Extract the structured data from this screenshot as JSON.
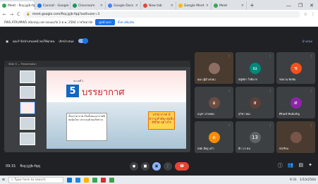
{
  "tabs": [
    {
      "label": "Meet - fkq-jyjb-fqq",
      "color": "#34a853",
      "active": true
    },
    {
      "label": "Cannot - Google Drive",
      "color": "#1a73e8"
    },
    {
      "label": "Classroom",
      "color": "#0f9d58"
    },
    {
      "label": "Google Docs",
      "color": "#4285f4"
    },
    {
      "label": "New tab",
      "color": "#ea4335"
    },
    {
      "label": "Google Meet",
      "color": "#fbbc04"
    },
    {
      "label": "Meet",
      "color": "#34a853"
    }
  ],
  "new_tab": "+",
  "win": {
    "min": "—",
    "max": "❐",
    "close": "✕"
  },
  "address": {
    "back": "←",
    "forward": "→",
    "reload": "C",
    "url": "meet.google.com/fkq-jyjb-fqq?authuser=1",
    "star": "☆",
    "menu": "⋮"
  },
  "bookmarks": {
    "text": "PWS.ATRUMWS สนับสนุน อย่างปลอดภัย 2 ต.ค. 2564 ราชวิทยาลัย",
    "button": "ดูหน้าแรก",
    "link": "ตั้งค่าเพิ่มเติม"
  },
  "meet": {
    "presenting": "คุณกำลังนำเสนอหน้าจอให้ทุกคน",
    "stop": "เลิกนำเสนอ",
    "right": "นำเสนอ"
  },
  "slide": {
    "toolbar": "Slide 5 — Presentation",
    "label": "หน่วยที่ 2",
    "number": "5",
    "title": "บรรยากาศ",
    "box_text": "ชั้นบรรยากาศ เป็นชั้นของอากาศที่ห่อหุ้มโลก ประกอบด้วยแก๊สต่างๆ",
    "callout": "บรรยากาศ มีความสำคัญ ต่อสิ่งมีชีวิต อย่างไร"
  },
  "participants": [
    {
      "name": "คุณ (ผู้นำเสนอ)",
      "initial": "",
      "color": "#8d6e63",
      "video": true
    },
    {
      "name": "ณัฐธิดา ใจดีมาก",
      "initial": "ณ",
      "color": "#00897b"
    },
    {
      "name": "ชลนาน ทับทิม",
      "initial": "ช",
      "color": "#f4511e"
    },
    {
      "name": "อนุชา สายทอง",
      "initial": "อ",
      "color": "#6d4c41"
    },
    {
      "name": "สุวิชา ทอง",
      "initial": "ส",
      "color": "#5d4037"
    },
    {
      "name": "ศิรินทร์ ทิพย์เจริญ",
      "initial": "ศ",
      "color": "#8e24aa"
    },
    {
      "name": "ดนัย มีอยู่ แก้ว",
      "initial": "ด",
      "color": "#fb8c00"
    },
    {
      "name": "อีก 13 คน",
      "initial": "13",
      "color": "#5f6368"
    },
    {
      "name": "นักเรียน",
      "initial": "",
      "color": "#795548",
      "video": true
    }
  ],
  "bottom": {
    "time": "09:31",
    "code": "fkq-jyjb-fqq"
  },
  "controls": {
    "mic": "●",
    "cam": "■",
    "present": "▣",
    "more": "⋮",
    "end": "☎"
  },
  "right_controls": {
    "info": "ⓘ",
    "people": "👥",
    "chat": "▤",
    "activities": "✦"
  },
  "taskbar": {
    "search": "Type here to search",
    "time": "9:31",
    "date": "1/10/2564"
  }
}
